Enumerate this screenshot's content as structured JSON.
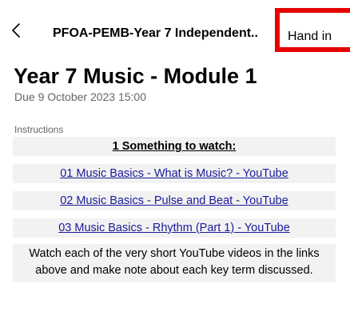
{
  "header": {
    "title": "PFOA-PEMB-Year 7 Independent..",
    "back_icon": "chevron-left-icon",
    "hand_in_label": "Hand in",
    "highlight_color": "#e60000"
  },
  "assignment": {
    "title": "Year 7 Music - Module 1",
    "due": "Due 9 October 2023 15:00"
  },
  "instructions": {
    "label": "Instructions",
    "heading": "1 Something to watch:",
    "links": [
      "01 Music Basics - What is Music? - YouTube",
      "02 Music Basics - Pulse and Beat - YouTube",
      "03 Music Basics - Rhythm (Part 1) - YouTube"
    ],
    "body": "Watch each of the very short YouTube videos in the links above and make note about each key term discussed."
  }
}
